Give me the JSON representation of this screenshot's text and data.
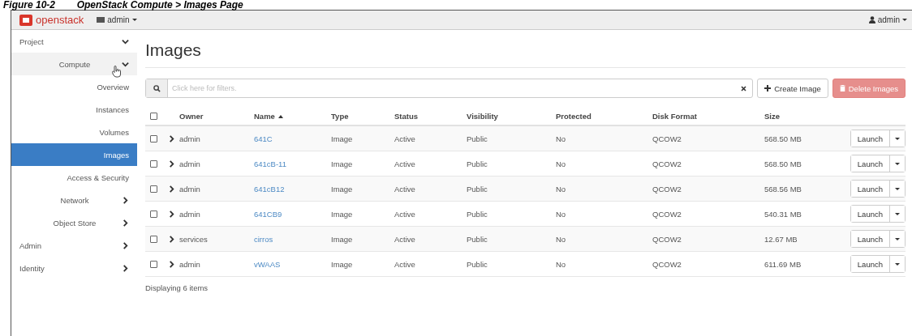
{
  "caption": "Figure 10-2        OpenStack Compute > Images Page",
  "topbar": {
    "logo": "openstack",
    "project_menu": "admin",
    "user_menu": "admin"
  },
  "sidebar": {
    "items": [
      {
        "label": "Project",
        "selected": false,
        "expanded": true,
        "children": [
          {
            "label": "Compute",
            "selected": false,
            "expanded": true,
            "children": [
              {
                "label": "Overview",
                "selected": false
              },
              {
                "label": "Instances",
                "selected": false
              },
              {
                "label": "Volumes",
                "selected": false
              },
              {
                "label": "Images",
                "selected": true
              },
              {
                "label": "Access & Security",
                "selected": false
              }
            ]
          },
          {
            "label": "Network",
            "selected": false,
            "expanded": false
          },
          {
            "label": "Object Store",
            "selected": false,
            "expanded": false
          }
        ]
      },
      {
        "label": "Admin",
        "selected": false,
        "expanded": false
      },
      {
        "label": "Identity",
        "selected": false,
        "expanded": false
      }
    ]
  },
  "content": {
    "title": "Images",
    "filter": {
      "placeholder": "Click here for filters."
    },
    "create_button": "Create Image",
    "delete_button": {
      "label": "Delete Images",
      "disabled": true
    },
    "table": {
      "columns": [
        {
          "label": "Owner",
          "sorted": false
        },
        {
          "label": "Name",
          "sorted": true
        },
        {
          "label": "Type",
          "sorted": false
        },
        {
          "label": "Status",
          "sorted": false
        },
        {
          "label": "Visibility",
          "sorted": false
        },
        {
          "label": "Protected",
          "sorted": false
        },
        {
          "label": "Disk Format",
          "sorted": false
        },
        {
          "label": "Size",
          "sorted": false
        }
      ],
      "select_all": {
        "checked": false
      },
      "rows": [
        {
          "checked": false,
          "cells": [
            "admin",
            "641C",
            "Image",
            "Active",
            "Public",
            "No",
            "QCOW2",
            "568.50 MB"
          ],
          "action": "Launch"
        },
        {
          "checked": false,
          "cells": [
            "admin",
            "641cB-11",
            "Image",
            "Active",
            "Public",
            "No",
            "QCOW2",
            "568.50 MB"
          ],
          "action": "Launch"
        },
        {
          "checked": false,
          "cells": [
            "admin",
            "641cB12",
            "Image",
            "Active",
            "Public",
            "No",
            "QCOW2",
            "568.56 MB"
          ],
          "action": "Launch"
        },
        {
          "checked": false,
          "cells": [
            "admin",
            "641CB9",
            "Image",
            "Active",
            "Public",
            "No",
            "QCOW2",
            "540.31 MB"
          ],
          "action": "Launch"
        },
        {
          "checked": false,
          "cells": [
            "services",
            "cirros",
            "Image",
            "Active",
            "Public",
            "No",
            "QCOW2",
            "12.67 MB"
          ],
          "action": "Launch"
        },
        {
          "checked": false,
          "cells": [
            "admin",
            "vWAAS",
            "Image",
            "Active",
            "Public",
            "No",
            "QCOW2",
            "611.69 MB"
          ],
          "action": "Launch"
        }
      ]
    },
    "footer": "Displaying 6 items"
  }
}
